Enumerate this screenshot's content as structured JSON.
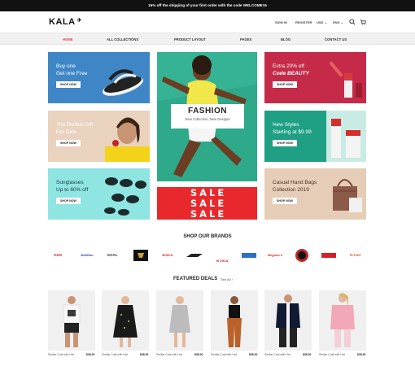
{
  "topbar": {
    "text": "15% off the shipping of your first order with the code WELCOME15"
  },
  "header": {
    "logo": "KALA",
    "links": [
      "SIGN IN",
      "REGISTER",
      "USD",
      "ENG"
    ]
  },
  "nav": {
    "items": [
      "HOME",
      "ALL COLLECTIONS",
      "PRODUCT LAYOUT",
      "PAGES",
      "BLOG",
      "CONTACT US"
    ]
  },
  "banners": {
    "buy_one": {
      "title1": "Buy one",
      "title2": "Get one Free",
      "button": "SHOP NOW"
    },
    "perfect_gift": {
      "title1": "The Perfect Gift",
      "title2": "For Girls",
      "button": "SHOP NOW"
    },
    "sunglasses": {
      "title1": "Sunglasses",
      "title2": "Up to 60% off",
      "button": "SHOP NOW"
    },
    "fashion": {
      "title": "FASHION",
      "subtitle": "New Collection, New Designs"
    },
    "sale": {
      "words": [
        "SALE",
        "SALE",
        "SALE"
      ]
    },
    "extra": {
      "title1": "Extra 20% off",
      "title2": "Code BEAUTY",
      "button": "SHOP NOW"
    },
    "new_styles": {
      "title1": "New Styles",
      "title2": "Starting at $9.99",
      "button": "SHOP NOW"
    },
    "hand_bags": {
      "title1": "Casual Hand Bags",
      "title2": "Collection 2019",
      "button": "SHOP NOW"
    }
  },
  "brands_section": {
    "title": "SHOP OUR BRANDS",
    "brands": [
      "K&N",
      "McMillan",
      "GOAL",
      "",
      "BOSCH",
      "",
      "N 1914",
      "",
      "Meguiar's",
      "",
      "",
      "H.Carr"
    ]
  },
  "featured": {
    "title": "FEATURED DEALS",
    "see_all": "See All",
    "products": [
      {
        "name": "Similar Coat with Hat",
        "price": "$38.00"
      },
      {
        "name": "Similar Coat with Hat",
        "price": "$38.00"
      },
      {
        "name": "Similar Coat with Hat",
        "price": "$38.00"
      },
      {
        "name": "Similar Coat with Hat",
        "price": "$38.00"
      },
      {
        "name": "Similar Coat with Hat",
        "price": "$38.00"
      },
      {
        "name": "Similar Coat with Hat",
        "price": "$38.00"
      }
    ]
  },
  "colors": {
    "blue_tile": "#3f86c7",
    "peach_tile": "#e9d3bf",
    "cyan_tile": "#8fe5e2",
    "green_tile": "#36a67a",
    "red_tile": "#c52b48",
    "teal_tile": "#1f9f84",
    "beige_tile": "#e6cdb7",
    "sale_red": "#e8282c",
    "accent": "#e84545"
  },
  "icons": [
    "search-icon",
    "cart-icon",
    "chevron-down-icon"
  ]
}
